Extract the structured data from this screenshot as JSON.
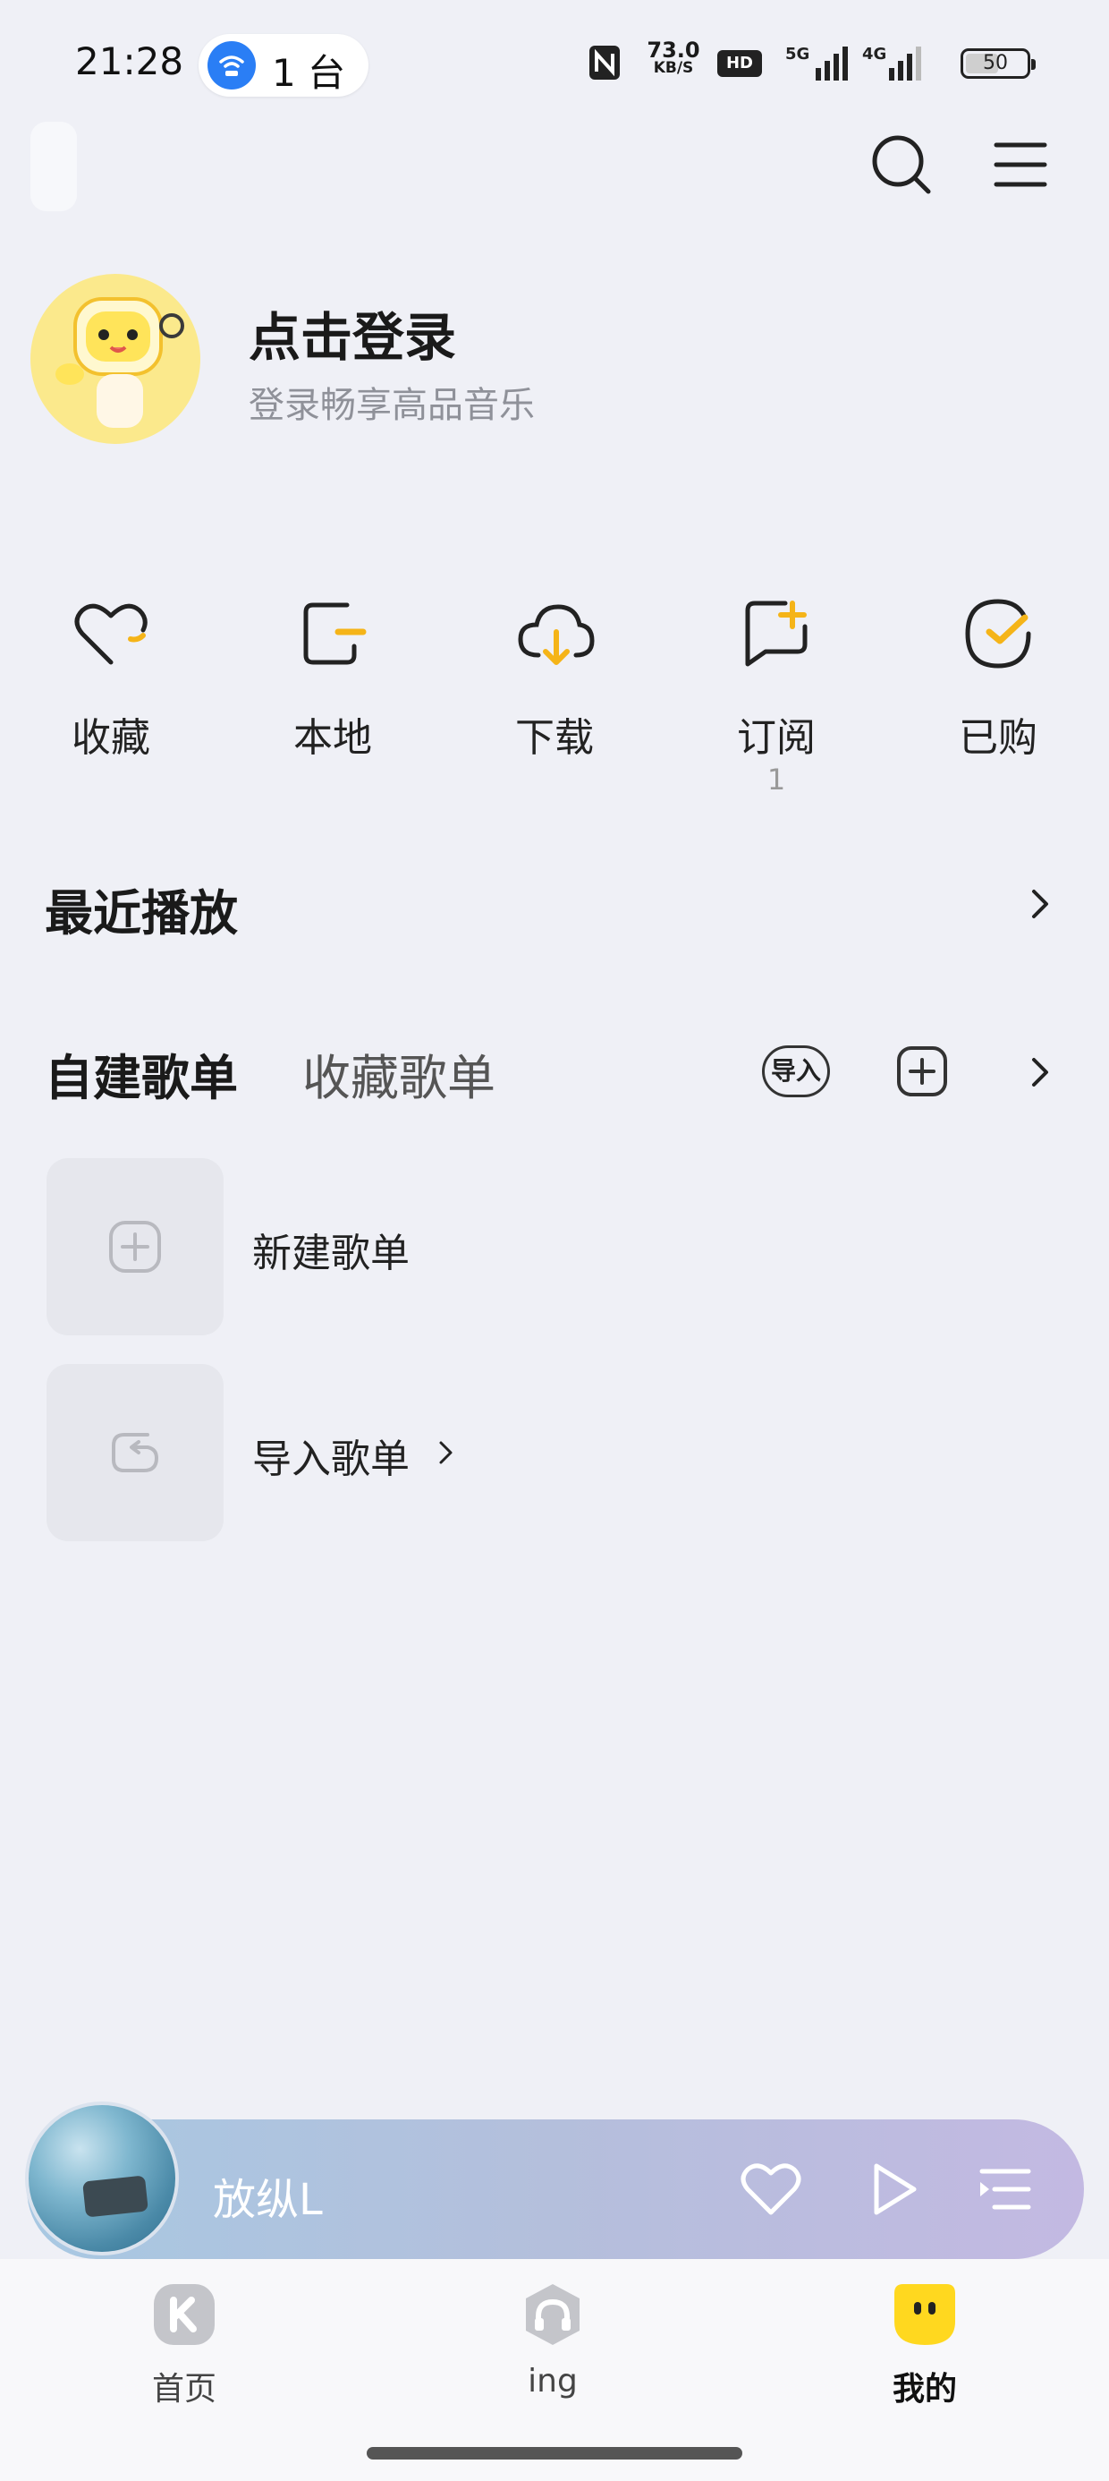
{
  "status_bar": {
    "time": "21:28",
    "cast_count": "1 台",
    "net_speed_value": "73.0",
    "net_speed_unit": "KB/S",
    "hd_badge": "HD",
    "signal_5g": "5G",
    "signal_4g": "4G",
    "battery_level": "50"
  },
  "profile": {
    "title": "点击登录",
    "subtitle": "登录畅享高品音乐"
  },
  "quick_entries": [
    {
      "label": "收藏",
      "icon": "heart-icon"
    },
    {
      "label": "本地",
      "icon": "phone-local-icon"
    },
    {
      "label": "下载",
      "icon": "cloud-download-icon"
    },
    {
      "label": "订阅",
      "icon": "bookmark-add-icon",
      "count": "1"
    },
    {
      "label": "已购",
      "icon": "check-circle-icon"
    }
  ],
  "recent": {
    "title": "最近播放"
  },
  "playlists": {
    "tab_active": "自建歌单",
    "tab_inactive": "收藏歌单",
    "import_label": "导入",
    "rows": [
      {
        "label": "新建歌单",
        "icon": "plus-square-icon"
      },
      {
        "label": "导入歌单",
        "icon": "import-icon"
      }
    ]
  },
  "mini_player": {
    "song": "放纵L"
  },
  "bottom_nav": [
    {
      "label": "首页",
      "icon": "home-k-icon"
    },
    {
      "label": "ing",
      "icon": "headphones-icon"
    },
    {
      "label": "我的",
      "icon": "mine-face-icon",
      "active": true
    }
  ],
  "colors": {
    "background": "#eff0f6",
    "accent": "#f5b418",
    "text_primary": "#1a1a1a",
    "text_secondary": "#8f9199"
  }
}
